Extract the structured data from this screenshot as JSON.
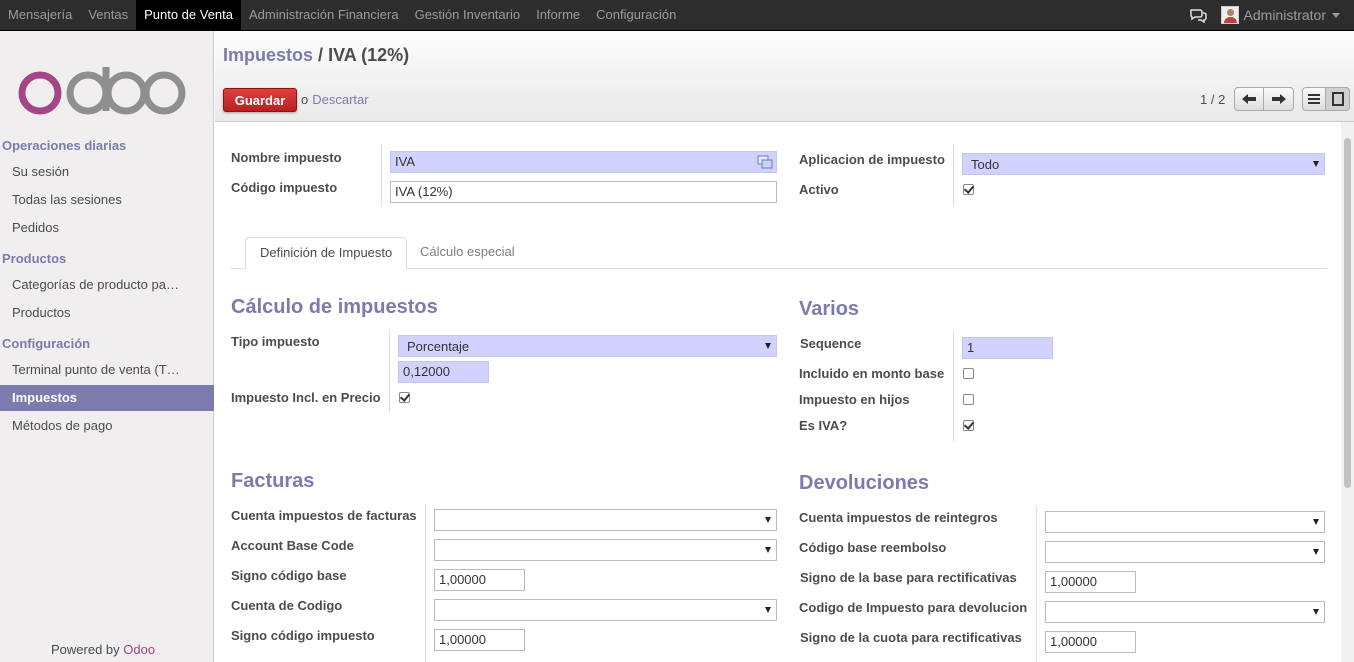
{
  "topbar": {
    "menu": [
      "Mensajería",
      "Ventas",
      "Punto de Venta",
      "Administración Financiera",
      "Gestión Inventario",
      "Informe",
      "Configuración"
    ],
    "active_index": 2,
    "user_name": "Administrator",
    "chat_icon": "chat-bubbles-icon"
  },
  "sidebar": {
    "logo_text": "odoo",
    "sections": [
      {
        "title": "Operaciones diarias",
        "items": [
          "Su sesión",
          "Todas las sesiones",
          "Pedidos"
        ]
      },
      {
        "title": "Productos",
        "items": [
          "Categorías de producto para punto de venta",
          "Productos"
        ]
      },
      {
        "title": "Configuración",
        "items": [
          "Terminal punto de venta (TPV)",
          "Impuestos",
          "Métodos de pago"
        ]
      }
    ],
    "active_item": "Impuestos",
    "powered_prefix": "Powered by",
    "powered_brand": "Odoo"
  },
  "header": {
    "breadcrumb_parent": "Impuestos",
    "breadcrumb_sep": "/",
    "breadcrumb_current": "IVA (12%)",
    "save_label": "Guardar",
    "or_label": "o",
    "discard_label": "Descartar",
    "pager": "1 / 2"
  },
  "form": {
    "name_label": "Nombre impuesto",
    "name_value": "IVA",
    "code_label": "Código impuesto",
    "code_value": "IVA (12%)",
    "application_label": "Aplicacion de impuesto",
    "application_value": "Todo",
    "active_label": "Activo",
    "active_checked": true,
    "tabs": [
      "Definición de Impuesto",
      "Cálculo especial"
    ],
    "active_tab": 0,
    "calc_title": "Cálculo de impuestos",
    "tax_type_label": "Tipo impuesto",
    "tax_type_value": "Porcentaje",
    "amount_value": "0,12000",
    "price_include_label": "Impuesto Incl. en Precio",
    "price_include_checked": true,
    "misc_title": "Varios",
    "sequence_label": "Sequence",
    "sequence_value": "1",
    "include_base_label": "Incluido en monto base",
    "include_base_checked": false,
    "child_depend_label": "Impuesto en hijos",
    "child_depend_checked": false,
    "is_vat_label": "Es IVA?",
    "is_vat_checked": true,
    "invoices_title": "Facturas",
    "invoices": [
      {
        "label": "Cuenta impuestos de facturas",
        "type": "select",
        "value": ""
      },
      {
        "label": "Account Base Code",
        "type": "select",
        "value": ""
      },
      {
        "label": "Signo código base",
        "type": "input",
        "value": "1,00000"
      },
      {
        "label": "Cuenta de Codigo",
        "type": "select",
        "value": ""
      },
      {
        "label": "Signo código impuesto",
        "type": "input",
        "value": "1,00000"
      }
    ],
    "refunds_title": "Devoluciones",
    "refunds": [
      {
        "label": "Cuenta impuestos de reintegros",
        "type": "select",
        "value": ""
      },
      {
        "label": "Código base reembolso",
        "type": "select",
        "value": ""
      },
      {
        "label": "Signo de la base para rectificativas",
        "type": "input",
        "value": "1,00000"
      },
      {
        "label": "Codigo de Impuesto para devolucion",
        "type": "select",
        "value": ""
      },
      {
        "label": "Signo de la cuota para rectificativas",
        "type": "input",
        "value": "1,00000"
      }
    ]
  },
  "colors": {
    "accent": "#7c7bad",
    "brand": "#a24689",
    "required_bg": "#d2d2ff",
    "save_button": "#c9302c",
    "topbar_bg": "#2d2d2d"
  }
}
